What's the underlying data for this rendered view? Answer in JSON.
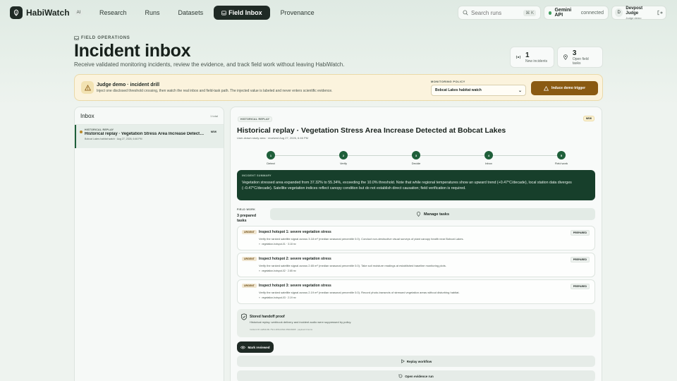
{
  "app": {
    "name": "HabiWatch",
    "badge": "AI"
  },
  "nav": {
    "links": [
      "Research",
      "Runs",
      "Datasets",
      "Field Inbox",
      "Provenance"
    ],
    "active": "Field Inbox",
    "search_placeholder": "Search runs",
    "search_shortcut": "⌘ K",
    "api_name": "Gemini API",
    "api_status": "connected",
    "user_initial": "D",
    "user_name": "Devpost Judge",
    "user_role": "Judge demo"
  },
  "header": {
    "eyebrow": "FIELD OPERATIONS",
    "title": "Incident inbox",
    "subtitle": "Receive validated monitoring incidents, review the evidence, and track field work without leaving HabiWatch.",
    "stats": [
      {
        "value": "1",
        "label": "New incidents",
        "icon": "radio-icon"
      },
      {
        "value": "3",
        "label": "Open field tasks",
        "icon": "map-pin-icon"
      }
    ]
  },
  "demo": {
    "title": "Judge demo · incident drill",
    "description": "Inject one disclosed threshold crossing, then watch the real inbox and field-task path. The injected value is labeled and never enters scientific evidence.",
    "policy_label": "MONITORING POLICY",
    "policy_value": "Bobcat Lakes habitat watch",
    "trigger_label": "Induce demo trigger"
  },
  "inbox": {
    "title": "Inbox",
    "total": "1 total",
    "items": [
      {
        "eyebrow": "HISTORICAL REPLAY",
        "title": "Historical replay · Vegetation Stress Area Increase Detected at Bobcat Lakes",
        "meta": "Bobcat Lakes habitat watch · Aug 27, 2026, 6:46 PM",
        "badge": "NEW"
      }
    ]
  },
  "detail": {
    "eyebrow": "HISTORICAL REPLAY",
    "badge": "NEW",
    "title": "Historical replay · Vegetation Stress Area Increase Detected at Bobcat Lakes",
    "meta": "User-drawn study area · received Aug 27, 2026, 6:46 PM",
    "steps": [
      {
        "num": "1",
        "label": "Detect"
      },
      {
        "num": "2",
        "label": "Verify"
      },
      {
        "num": "3",
        "label": "Decide"
      },
      {
        "num": "4",
        "label": "Inbox"
      },
      {
        "num": "5",
        "label": "Field work"
      }
    ],
    "summary_label": "INCIDENT SUMMARY",
    "summary_text": "Vegetation stressed area expanded from 37.32% to 55.34%, exceeding the 10.0% threshold. Note that while regional temperatures show an upward trend (+0.47°C/decade), local station data diverges (−0.47°C/decade). Satellite vegetation indices reflect canopy condition but do not establish direct causation; field verification is required.",
    "field_work_label": "FIELD WORK",
    "field_work_count": "3 prepared tasks",
    "manage_label": "Manage tasks",
    "tasks": [
      {
        "priority": "URGENT",
        "title": "Inspect hotspot 1: severe vegetation stress",
        "status": "PREPARED",
        "description": "Verify the ranked satellite signal across 3.18 m² (median seasonal percentile 0.0). Conduct non-destructive visual surveys of plant canopy health near Bobcat Lakes.",
        "tag": "vegetation-hotspot-01 · 3.18 m²"
      },
      {
        "priority": "URGENT",
        "title": "Inspect hotspot 2: severe vegetation stress",
        "status": "PREPARED",
        "description": "Verify the ranked satellite signal across 2.65 m² (median seasonal percentile 0.0). Take soil moisture readings at established baseline monitoring plots.",
        "tag": "vegetation-hotspot-02 · 2.65 m²"
      },
      {
        "priority": "URGENT",
        "title": "Inspect hotspot 3: severe vegetation stress",
        "status": "PREPARED",
        "description": "Verify the ranked satellite signal across 2.19 m² (median seasonal percentile 0.0). Record photo-transects of stressed vegetation areas without disturbing habitat.",
        "tag": "vegetation-hotspot-03 · 2.19 m²"
      }
    ],
    "proof_title": "Stored handoff proof",
    "proof_desc": "Historical replay: webhook delivery and incident audio were suppressed by policy.",
    "proof_hash": "Incident ID ca8b4c9b-75c4-4f6b-b84d-6f6d4b998 · payload 4 items",
    "mark_label": "Mark reviewed",
    "replay_label": "Replay workflow",
    "open_run_label": "Open evidence run"
  },
  "colors": {
    "accent": "#1f5f3a",
    "dark": "#1f2a25",
    "trigger": "#8a5a12",
    "summary_bg": "#173f2b"
  }
}
